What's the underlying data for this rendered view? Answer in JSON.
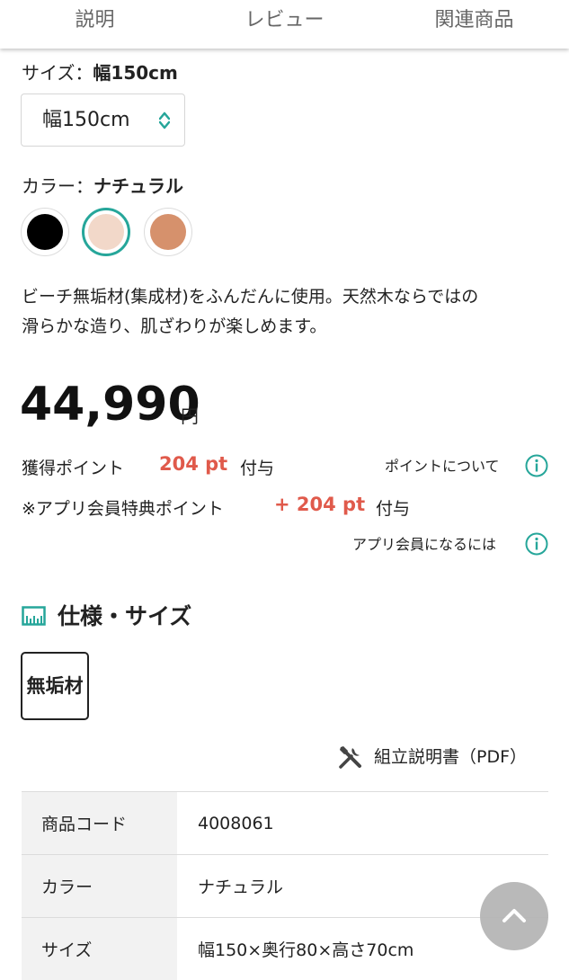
{
  "tabs": [
    "説明",
    "レビュー",
    "関連商品"
  ],
  "size": {
    "label": "サイズ：",
    "selected": "幅150cm",
    "dropdown_value": "幅150cm"
  },
  "color": {
    "label": "カラー：",
    "selected": "ナチュラル",
    "swatches": [
      {
        "name": "black",
        "hex": "#000000",
        "selected": false
      },
      {
        "name": "natural",
        "hex": "#f2d8c9",
        "selected": true
      },
      {
        "name": "brown",
        "hex": "#d6916c",
        "selected": false
      }
    ],
    "selected_ring_color": "#26a69a"
  },
  "description": {
    "line1": "ビーチ無垢材(集成材)をふんだんに使用。天然木ならではの",
    "line2": "滑らかな造り、肌ざわりが楽しめます。"
  },
  "price": {
    "amount": "44,990",
    "unit": "円"
  },
  "points": {
    "earned_label": "獲得ポイント",
    "earned_value": "204 pt",
    "earned_suffix": "付与",
    "about_link": "ポイントについて",
    "app_label": "※アプリ会員特典ポイント",
    "app_value": "+ 204 pt",
    "app_suffix": "付与",
    "app_link": "アプリ会員になるには",
    "accent_color": "#e05a4b"
  },
  "specs": {
    "heading": "仕様・サイズ",
    "badge": "無垢材",
    "pdf_link": "組立説明書（PDF）",
    "rows": [
      {
        "key": "商品コード",
        "value": "4008061"
      },
      {
        "key": "カラー",
        "value": "ナチュラル"
      },
      {
        "key": "サイズ",
        "value": "幅150×奥行80×高さ70cm"
      }
    ]
  }
}
